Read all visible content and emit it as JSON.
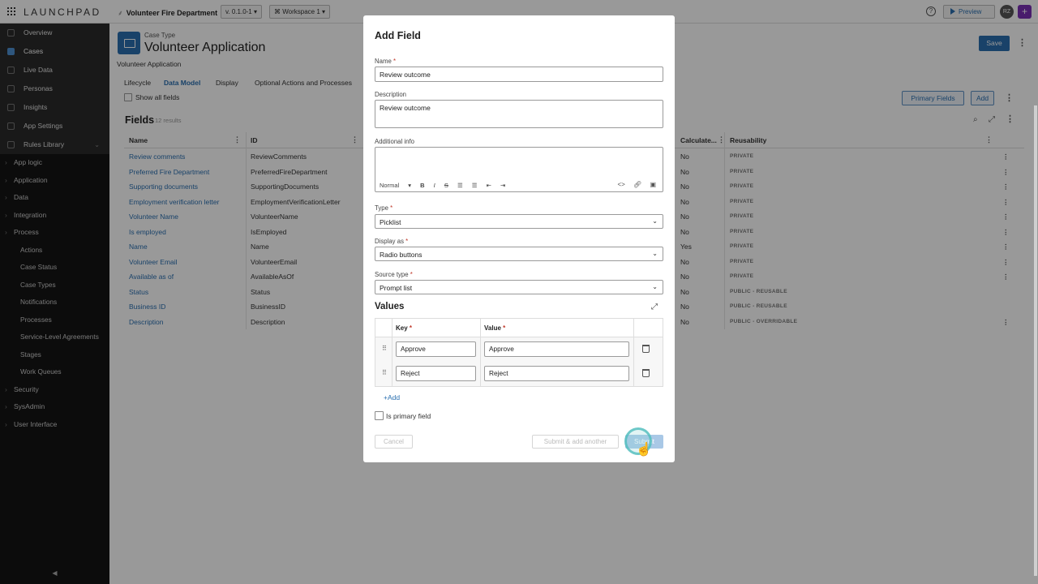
{
  "topbar": {
    "brand": "LAUNCHPAD",
    "app_name": "Volunteer Fire Department",
    "version": "v. 0.1.0-1",
    "workspace": "Workspace 1",
    "help": "?",
    "preview": "Preview",
    "avatar": "RZ",
    "plus": "+"
  },
  "sidebar": {
    "top_items": [
      {
        "label": "Overview"
      },
      {
        "label": "Cases"
      },
      {
        "label": "Live Data"
      },
      {
        "label": "Personas"
      },
      {
        "label": "Insights"
      },
      {
        "label": "App Settings"
      },
      {
        "label": "Rules Library"
      }
    ],
    "sections": [
      "App logic",
      "Application",
      "Data",
      "Integration",
      "Process"
    ],
    "process_items": [
      "Actions",
      "Case Status",
      "Case Types",
      "Notifications",
      "Processes",
      "Service-Level Agreements",
      "Stages",
      "Work Queues"
    ],
    "bottom_sections": [
      "Security",
      "SysAdmin",
      "User Interface"
    ]
  },
  "header": {
    "case_type_label": "Case Type",
    "title": "Volunteer Application",
    "subtitle": "Volunteer Application",
    "save": "Save"
  },
  "tabs": [
    "Lifecycle",
    "Data Model",
    "Display",
    "Optional Actions and Processes"
  ],
  "toolbar": {
    "show_all": "Show all fields",
    "primary_fields": "Primary Fields",
    "add": "Add"
  },
  "fields": {
    "title": "Fields",
    "count": "12 results",
    "columns": {
      "name": "Name",
      "id": "ID",
      "calculated": "Calculate...",
      "reusability": "Reusability"
    },
    "rows": [
      {
        "name": "Review comments",
        "id": "ReviewComments",
        "calc": "No",
        "reuse": "PRIVATE",
        "menu": true
      },
      {
        "name": "Preferred Fire Department",
        "id": "PreferredFireDepartment",
        "calc": "No",
        "reuse": "PRIVATE",
        "menu": true
      },
      {
        "name": "Supporting documents",
        "id": "SupportingDocuments",
        "calc": "No",
        "reuse": "PRIVATE",
        "menu": true
      },
      {
        "name": "Employment verification letter",
        "id": "EmploymentVerificationLetter",
        "calc": "No",
        "reuse": "PRIVATE",
        "menu": true
      },
      {
        "name": "Volunteer Name",
        "id": "VolunteerName",
        "calc": "No",
        "reuse": "PRIVATE",
        "menu": true
      },
      {
        "name": "Is employed",
        "id": "IsEmployed",
        "calc": "No",
        "reuse": "PRIVATE",
        "menu": true
      },
      {
        "name": "Name",
        "id": "Name",
        "calc": "Yes",
        "reuse": "PRIVATE",
        "menu": true
      },
      {
        "name": "Volunteer Email",
        "id": "VolunteerEmail",
        "calc": "No",
        "reuse": "PRIVATE",
        "menu": true
      },
      {
        "name": "Available as of",
        "id": "AvailableAsOf",
        "calc": "No",
        "reuse": "PRIVATE",
        "menu": true
      },
      {
        "name": "Status",
        "id": "Status",
        "calc": "No",
        "reuse": "PUBLIC - REUSABLE",
        "menu": false
      },
      {
        "name": "Business ID",
        "id": "BusinessID",
        "calc": "No",
        "reuse": "PUBLIC - REUSABLE",
        "menu": false
      },
      {
        "name": "Description",
        "id": "Description",
        "calc": "No",
        "reuse": "PUBLIC - OVERRIDABLE",
        "menu": true
      }
    ]
  },
  "modal": {
    "title": "Add Field",
    "name_label": "Name",
    "name_value": "Review outcome",
    "description_label": "Description",
    "description_value": "Review outcome",
    "additional_info_label": "Additional info",
    "rte_format": "Normal",
    "type_label": "Type",
    "type_value": "Picklist",
    "display_label": "Display as",
    "display_value": "Radio buttons",
    "source_label": "Source type",
    "source_value": "Prompt list",
    "required_mark": "*",
    "values_title": "Values",
    "key_header": "Key",
    "value_header": "Value",
    "values": [
      {
        "key": "Approve",
        "value": "Approve"
      },
      {
        "key": "Reject",
        "value": "Reject"
      }
    ],
    "add_link": "Add",
    "primary_field": "Is primary field",
    "cancel": "Cancel",
    "submit_add_another": "Submit & add another",
    "submit": "Submit"
  }
}
